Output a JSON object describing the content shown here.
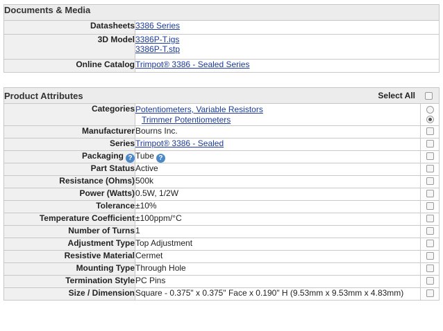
{
  "documents": {
    "title": "Documents & Media",
    "rows": [
      {
        "label": "Datasheets",
        "links": [
          "3386 Series"
        ]
      },
      {
        "label": "3D Model",
        "links": [
          "3386P-T.igs",
          "3386P-T.stp"
        ]
      },
      {
        "label": "Online Catalog",
        "links": [
          "Trimpot® 3386 - Sealed Series"
        ]
      }
    ]
  },
  "attributes": {
    "title": "Product Attributes",
    "select_all": "Select All",
    "categories_label": "Categories",
    "categories": [
      "Potentiometers, Variable Resistors",
      "Trimmer Potentiometers"
    ],
    "rows": [
      {
        "label": "Manufacturer",
        "value": "Bourns Inc."
      },
      {
        "label": "Series",
        "value": "Trimpot® 3386 - Sealed",
        "link": true
      },
      {
        "label": "Packaging",
        "value": "Tube",
        "help": true
      },
      {
        "label": "Part Status",
        "value": "Active"
      },
      {
        "label": "Resistance (Ohms)",
        "value": "500k"
      },
      {
        "label": "Power (Watts)",
        "value": "0.5W, 1/2W"
      },
      {
        "label": "Tolerance",
        "value": "±10%"
      },
      {
        "label": "Temperature Coefficient",
        "value": "±100ppm/°C"
      },
      {
        "label": "Number of Turns",
        "value": "1"
      },
      {
        "label": "Adjustment Type",
        "value": "Top Adjustment"
      },
      {
        "label": "Resistive Material",
        "value": "Cermet"
      },
      {
        "label": "Mounting Type",
        "value": "Through Hole"
      },
      {
        "label": "Termination Style",
        "value": "PC Pins"
      },
      {
        "label": "Size / Dimension",
        "value": "Square - 0.375\" x 0.375\" Face x 0.190\" H (9.53mm x 9.53mm x 4.83mm)"
      }
    ]
  }
}
